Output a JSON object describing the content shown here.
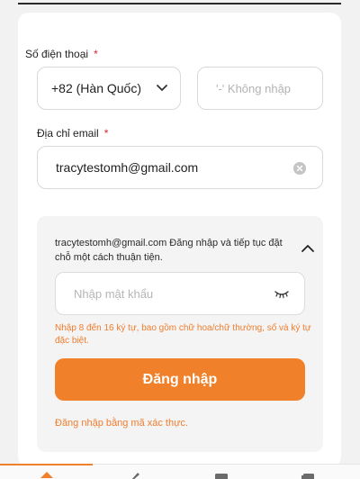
{
  "phone": {
    "label": "Số điện thoại",
    "required_mark": "*",
    "country_value": "+82 (Hàn Quốc)",
    "number_placeholder": "'-' Không nhập"
  },
  "email": {
    "label": "Địa chỉ email",
    "required_mark": "*",
    "value": "tracytestomh@gmail.com"
  },
  "login_panel": {
    "message": "tracytestomh@gmail.com Đăng nhập và tiếp tục đặt chỗ một cách thuận tiện.",
    "password_placeholder": "Nhập mật khẩu",
    "hint": "Nhập 8 đến 16 ký tự, bao gồm chữ hoa/chữ thường, số và ký tự đặc biệt.",
    "login_button": "Đăng nhập",
    "alt_login_link": "Đăng nhập bằng mã xác thực."
  },
  "colors": {
    "accent": "#f0802a",
    "required": "#e0202f",
    "hint": "#f07d2e"
  },
  "icons": {
    "country_dropdown": "chevron-down-icon",
    "clear_email": "clear-icon",
    "collapse_panel": "chevron-up-icon",
    "toggle_password": "eye-closed-icon",
    "nav": [
      "home-icon",
      "pen-icon",
      "document-icon",
      "list-icon"
    ]
  }
}
